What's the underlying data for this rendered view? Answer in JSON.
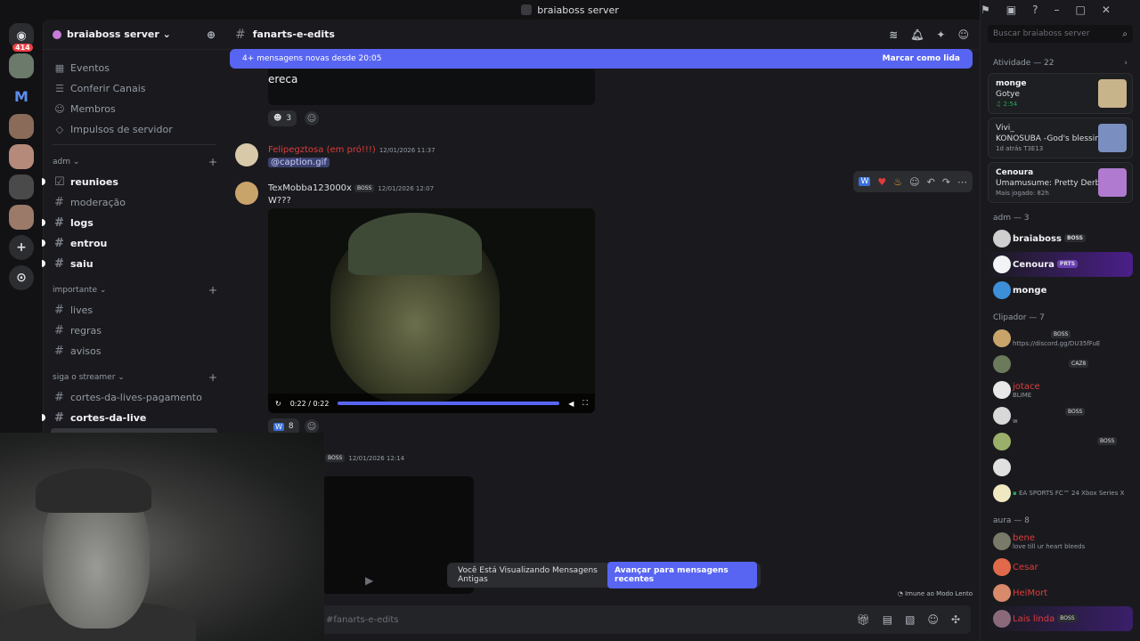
{
  "window": {
    "title": "braiaboss server"
  },
  "guilds": {
    "dm_badge": "414",
    "m_label": "M",
    "add_label": "+",
    "discover_label": "⊙"
  },
  "server": {
    "name": "braiaboss server ⌄"
  },
  "nav": [
    {
      "label": "Eventos",
      "icon": "calendar-icon"
    },
    {
      "label": "Conferir Canais",
      "icon": "list-icon"
    },
    {
      "label": "Membros",
      "icon": "members-icon"
    },
    {
      "label": "Impulsos de servidor",
      "icon": "boost-icon"
    }
  ],
  "categories": {
    "adm": "adm ⌄",
    "importante": "importante ⌄",
    "siga": "siga o streamer ⌄"
  },
  "channels": {
    "reunioes": "reunioes",
    "moderacao": "moderação",
    "logs": "logs",
    "entrou": "entrou",
    "saiu": "saiu",
    "lives": "lives",
    "regras": "regras",
    "avisos": "avisos",
    "cortes_pagamento": "cortes-da-lives-pagamento",
    "cortes_live": "cortes-da-live",
    "fanarts": "fanarts-e-edits"
  },
  "header": {
    "channel": "fanarts-e-edits"
  },
  "newbar": {
    "text": "4+ mensagens novas desde 20:05",
    "mark": "Marcar como lida"
  },
  "messages": {
    "m0_text": "ereca",
    "m0_reaction_count": "3",
    "m1_user": "Felipegztosa (em pró!!!)",
    "m1_ts": "12/01/2026 11:37",
    "m1_text": "@caption.gif",
    "m2_user": "TexMobba123000x",
    "m2_tag": "BOSS",
    "m2_ts": "12/01/2026 12:07",
    "m2_text": "W???",
    "m2_video_time": "0:22 / 0:22",
    "m2_reaction_count": "8",
    "m3_tag": "BOSS",
    "m3_ts": "12/01/2026 12:14"
  },
  "video": {
    "progress": 1.0
  },
  "banner": {
    "text": "Você Está Visualizando Mensagens Antigas",
    "button": "Avançar para mensagens recentes"
  },
  "composer": {
    "placeholder": "#fanarts-e-edits",
    "slowmode": "Imune ao Modo Lento"
  },
  "search": {
    "placeholder": "Buscar braiaboss server"
  },
  "activity": {
    "head": "Atividade — 22",
    "cards": [
      {
        "name": "monge",
        "game": "Gotye",
        "status": "2:54"
      },
      {
        "name": "Vivi_",
        "game": "KONOSUBA -God's blessin...",
        "status": "1d atrás    T3E13"
      },
      {
        "name": "Cenoura",
        "game": "Umamusume: Pretty Derby",
        "status": "Mais jogado: 82h"
      }
    ]
  },
  "groups": {
    "adm": "adm — 3",
    "clipador": "Clipador — 7",
    "aura": "aura — 8"
  },
  "members": {
    "braiaboss": "braiaboss",
    "braiaboss_tag": "BOSS",
    "cenoura": "Cenoura",
    "cenoura_tag": "PRTS",
    "monge": "monge",
    "c1_tag": "BOSS",
    "c1_status": "https://discord.gg/DU35fFuE",
    "c2_tag": "CAZ8",
    "jotace": "jotace",
    "jotace_status": "BLIME",
    "c4_tag": "BOSS",
    "c4_status": "w",
    "c5_tag": "BOSS",
    "c7_status": "EA SPORTS FC™ 24 Xbox Series X",
    "bene": "bene",
    "bene_status": "love till ur heart bleeds",
    "cesar": "Cesar",
    "heimort": "HeiMort",
    "lais": "Lais linda",
    "lais_tag": "BOSS"
  },
  "colors": {
    "accent": "#5865f2",
    "red_name": "#e03c3c",
    "green": "#23a55a"
  }
}
